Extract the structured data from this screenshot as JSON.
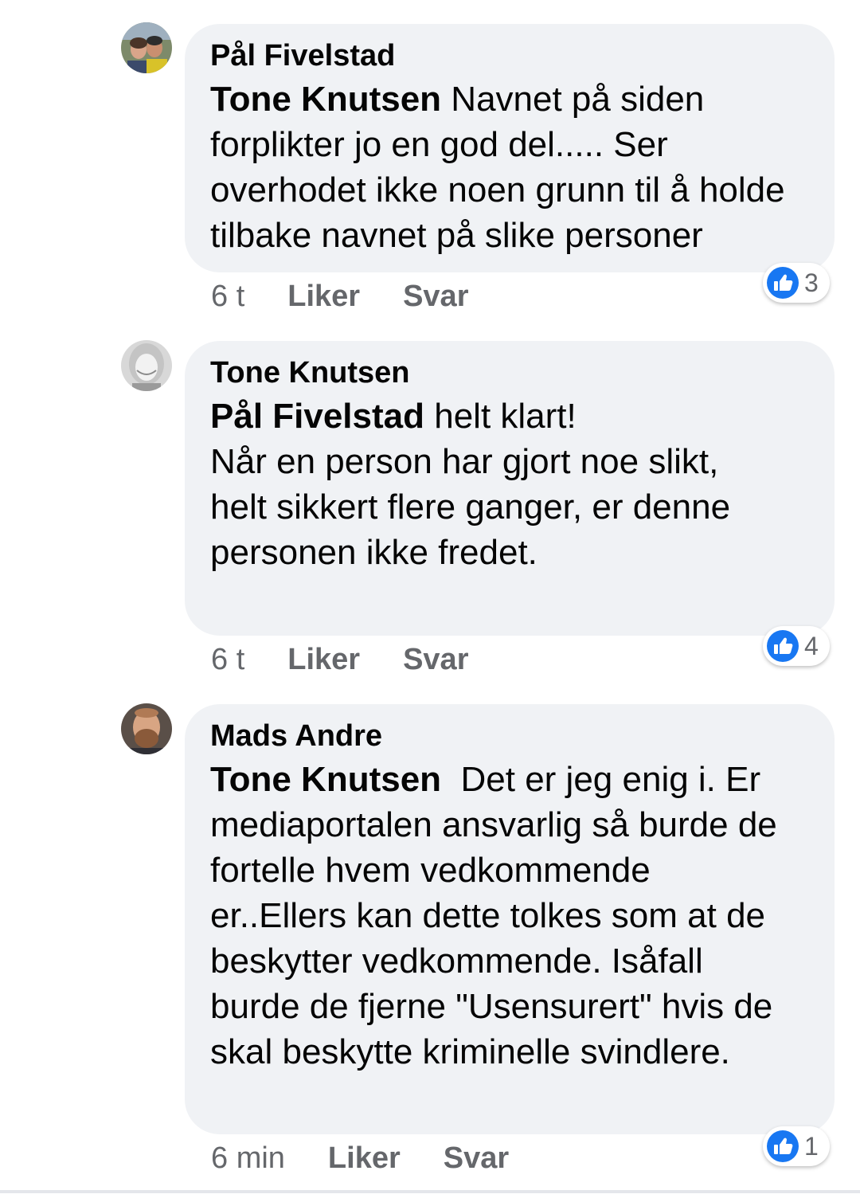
{
  "comments": [
    {
      "author": "Pål Fivelstad",
      "mention": "Tone Knutsen",
      "text": " Navnet på siden\nforplikter jo en god del..... Ser\noverhodet ikke noen grunn til å holde\ntilbake navnet på slike personer",
      "time": "6 t",
      "like_label": "Liker",
      "reply_label": "Svar",
      "reaction_count": "3",
      "reaction_icon": "thumbs-up-icon"
    },
    {
      "author": "Tone Knutsen",
      "mention": "Pål Fivelstad",
      "text": " helt klart!\nNår en person har gjort noe slikt,\nhelt sikkert flere ganger, er denne\npersonen ikke fredet.",
      "time": "6 t",
      "like_label": "Liker",
      "reply_label": "Svar",
      "reaction_count": "4",
      "reaction_icon": "thumbs-up-icon"
    },
    {
      "author": "Mads Andre",
      "mention": "Tone Knutsen",
      "text": "  Det er jeg enig i. Er\nmediaportalen ansvarlig så burde de\nfortelle hvem vedkommende\ner..Ellers kan dette tolkes som at de\nbeskytter vedkommende. Isåfall\nburde de fjerne \"Usensurert\" hvis de\nskal beskytte kriminelle svindlere.",
      "time": "6 min",
      "like_label": "Liker",
      "reply_label": "Svar",
      "reaction_count": "1",
      "reaction_icon": "thumbs-up-icon"
    }
  ],
  "colors": {
    "bubble": "#f0f2f5",
    "like_blue": "#1877f2",
    "meta_gray": "#65676b"
  }
}
